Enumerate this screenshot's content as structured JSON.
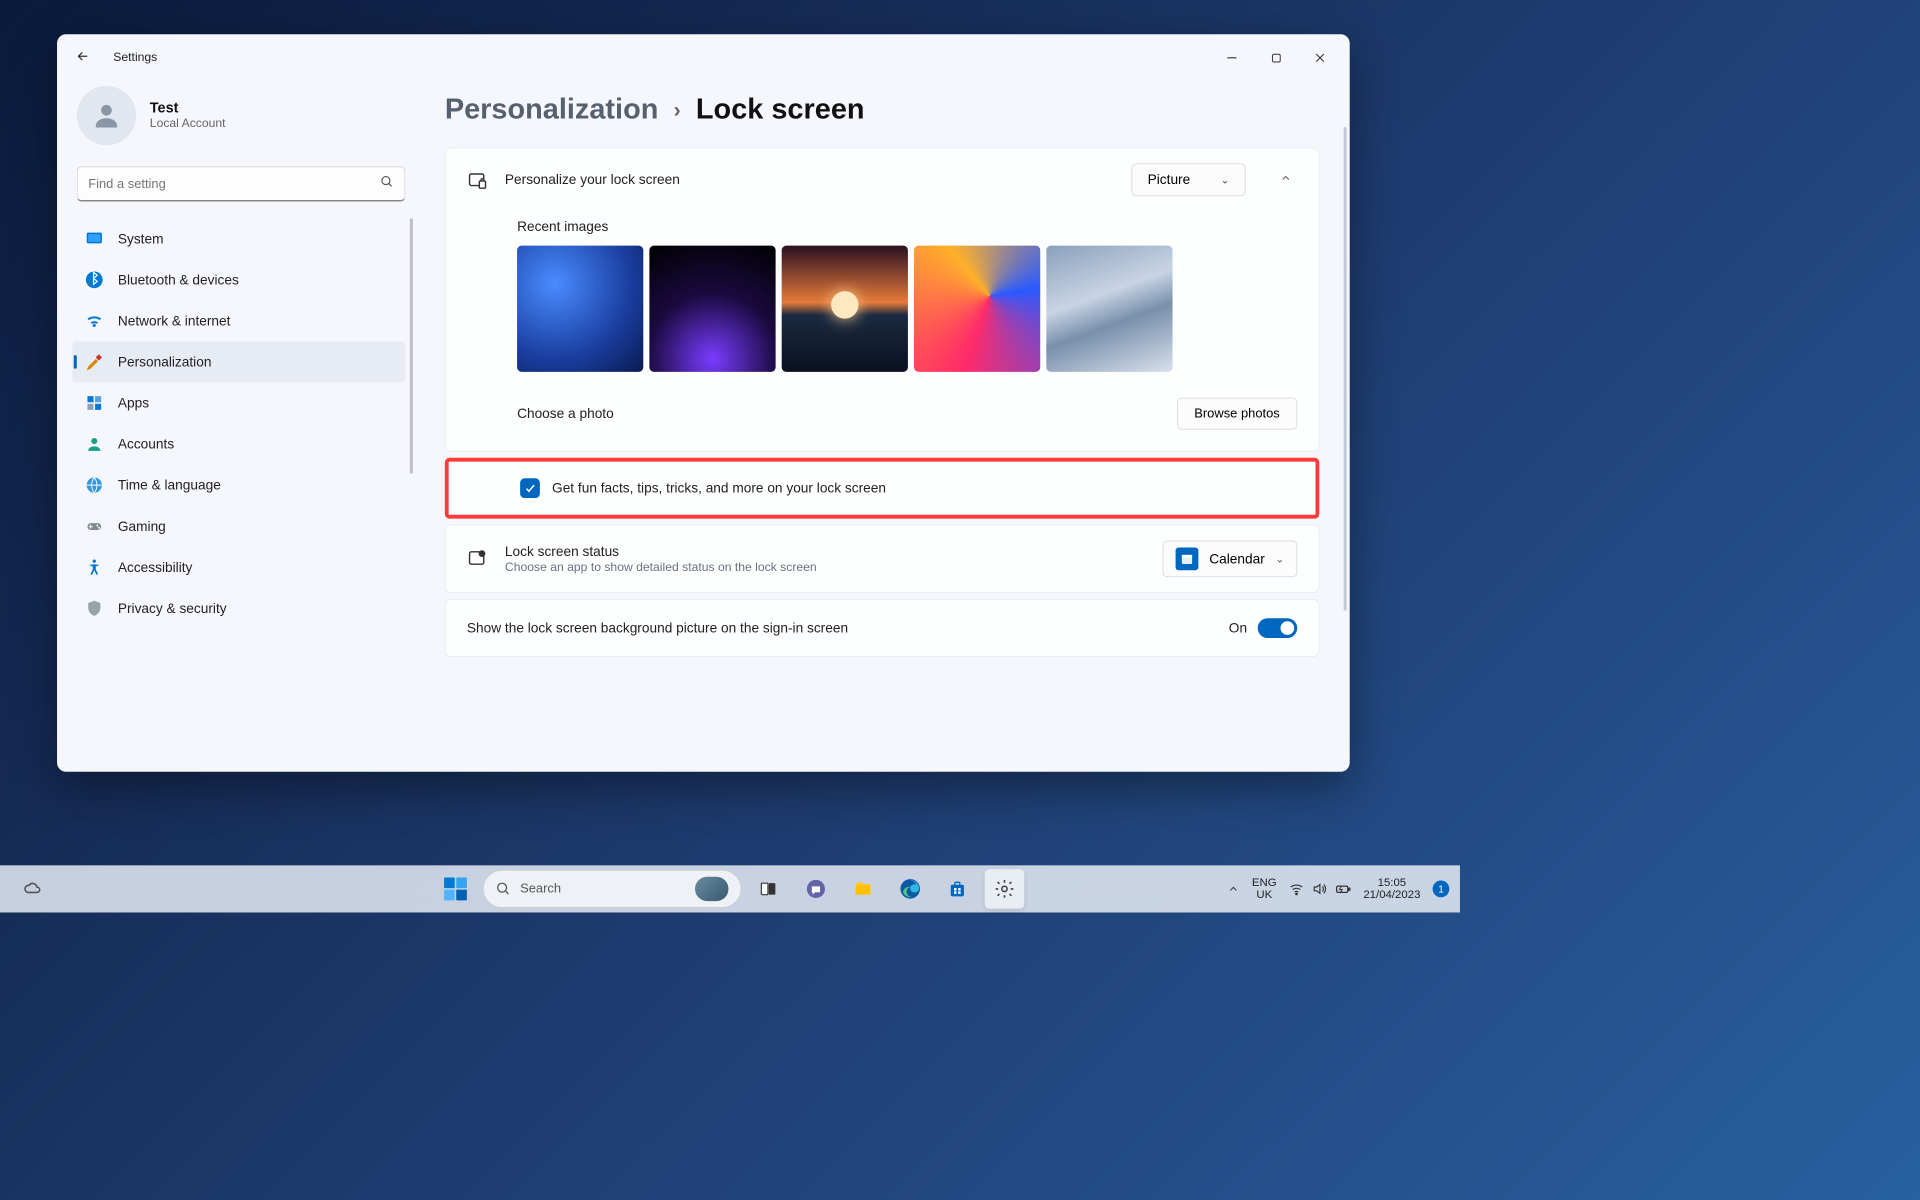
{
  "window": {
    "title": "Settings"
  },
  "profile": {
    "name": "Test",
    "subtitle": "Local Account"
  },
  "search": {
    "placeholder": "Find a setting"
  },
  "sidebar": {
    "items": [
      {
        "label": "System",
        "icon": "system",
        "active": false
      },
      {
        "label": "Bluetooth & devices",
        "icon": "bluetooth",
        "active": false
      },
      {
        "label": "Network & internet",
        "icon": "wifi",
        "active": false
      },
      {
        "label": "Personalization",
        "icon": "brush",
        "active": true
      },
      {
        "label": "Apps",
        "icon": "apps",
        "active": false
      },
      {
        "label": "Accounts",
        "icon": "person",
        "active": false
      },
      {
        "label": "Time & language",
        "icon": "globe",
        "active": false
      },
      {
        "label": "Gaming",
        "icon": "gamepad",
        "active": false
      },
      {
        "label": "Accessibility",
        "icon": "access",
        "active": false
      },
      {
        "label": "Privacy & security",
        "icon": "shield",
        "active": false
      }
    ]
  },
  "breadcrumb": {
    "parent": "Personalization",
    "current": "Lock screen"
  },
  "lockscreen": {
    "personalize_label": "Personalize your lock screen",
    "personalize_value": "Picture",
    "recent_label": "Recent images",
    "choose_label": "Choose a photo",
    "browse_label": "Browse photos",
    "funfacts_label": "Get fun facts, tips, tricks, and more on your lock screen",
    "funfacts_checked": true,
    "status": {
      "title": "Lock screen status",
      "subtitle": "Choose an app to show detailed status on the lock screen",
      "app": "Calendar"
    },
    "signin": {
      "label": "Show the lock screen background picture on the sign-in screen",
      "state": "On"
    }
  },
  "taskbar": {
    "search_label": "Search",
    "lang1": "ENG",
    "lang2": "UK",
    "time": "15:05",
    "date": "21/04/2023",
    "badge": "1"
  }
}
